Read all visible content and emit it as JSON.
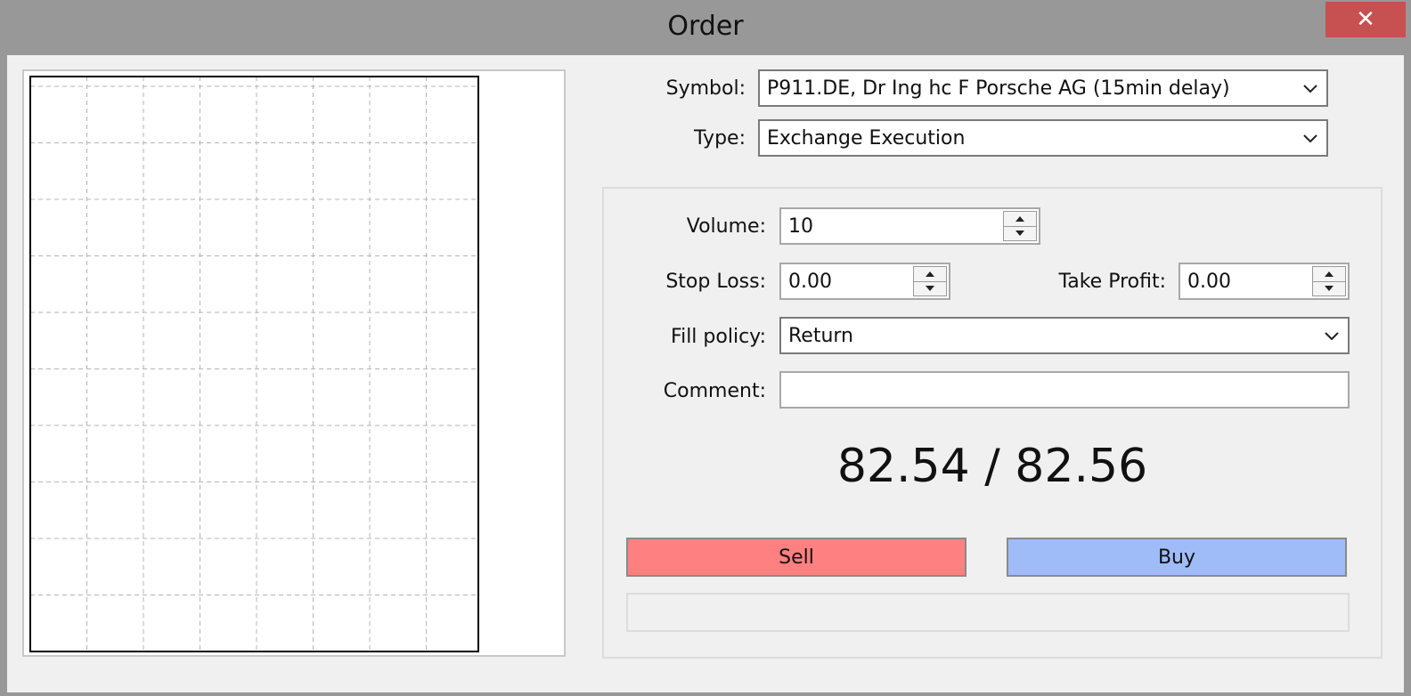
{
  "window": {
    "title": "Order",
    "close_glyph": "✕"
  },
  "form": {
    "symbol": {
      "label": "Symbol:",
      "value": "P911.DE, Dr Ing hc F Porsche AG (15min delay)"
    },
    "type": {
      "label": "Type:",
      "value": "Exchange Execution"
    },
    "volume": {
      "label": "Volume:",
      "value": "10"
    },
    "stop_loss": {
      "label": "Stop Loss:",
      "value": "0.00"
    },
    "take_profit": {
      "label": "Take Profit:",
      "value": "0.00"
    },
    "fill_policy": {
      "label": "Fill policy:",
      "value": "Return"
    },
    "comment": {
      "label": "Comment:",
      "value": ""
    }
  },
  "quote": {
    "bid_ask": "82.54 / 82.56"
  },
  "actions": {
    "sell_label": "Sell",
    "buy_label": "Buy"
  },
  "colors": {
    "sell": "#ff8080",
    "buy": "#a0bcf8",
    "close": "#c75050"
  },
  "chart": {
    "state": "empty",
    "grid": "dashed",
    "icons": [
      "chevron-down-icon",
      "spin-up-icon",
      "spin-down-icon",
      "close-icon"
    ]
  }
}
